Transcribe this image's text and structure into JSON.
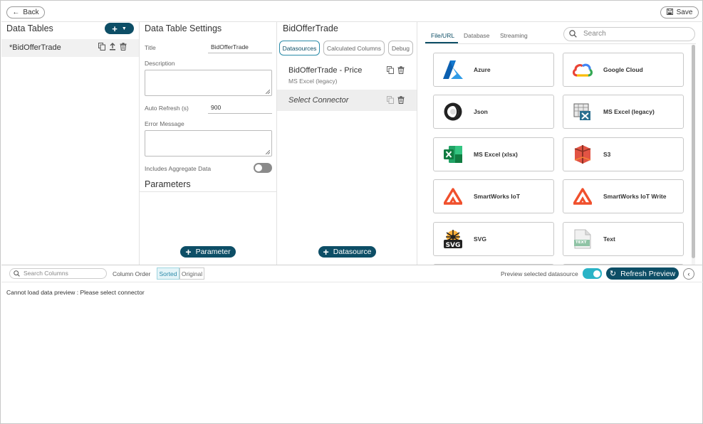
{
  "topbar": {
    "back_label": "Back",
    "save_label": "Save"
  },
  "data_tables": {
    "title": "Data Tables",
    "add_label": "+",
    "items": [
      {
        "label": "*BidOfferTrade"
      }
    ]
  },
  "settings": {
    "title": "Data Table Settings",
    "title_label": "Title",
    "title_value": "BidOfferTrade",
    "description_label": "Description",
    "auto_refresh_label": "Auto Refresh (s)",
    "auto_refresh_value": "900",
    "error_message_label": "Error Message",
    "aggregate_label": "Includes Aggregate Data",
    "aggregate_on": false,
    "parameters_title": "Parameters",
    "add_parameter_label": "Parameter"
  },
  "datasource_panel": {
    "title": "BidOfferTrade",
    "tabs": [
      "Datasources",
      "Calculated Columns",
      "Debug"
    ],
    "active_tab": "Datasources",
    "items": [
      {
        "name": "BidOfferTrade - Price",
        "sub": "MS Excel (legacy)"
      },
      {
        "name": "Select Connector",
        "sub": ""
      }
    ],
    "add_datasource_label": "Datasource"
  },
  "connectors": {
    "tabs": [
      "File/URL",
      "Database",
      "Streaming"
    ],
    "active_tab": "File/URL",
    "search_placeholder": "Search",
    "items": [
      {
        "label": "Azure",
        "icon": "azure-icon"
      },
      {
        "label": "Google Cloud",
        "icon": "google-cloud-icon"
      },
      {
        "label": "Json",
        "icon": "json-icon"
      },
      {
        "label": "MS Excel (legacy)",
        "icon": "excel-legacy-icon"
      },
      {
        "label": "MS Excel (xlsx)",
        "icon": "excel-xlsx-icon"
      },
      {
        "label": "S3",
        "icon": "s3-icon"
      },
      {
        "label": "SmartWorks IoT",
        "icon": "smartworks-icon"
      },
      {
        "label": "SmartWorks IoT Write",
        "icon": "smartworks-write-icon"
      },
      {
        "label": "SVG",
        "icon": "svg-icon"
      },
      {
        "label": "Text",
        "icon": "text-icon",
        "icon_text": "TEXT"
      }
    ]
  },
  "preview_bar": {
    "search_placeholder": "Search Columns",
    "column_order_label": "Column Order",
    "sorted_label": "Sorted",
    "original_label": "Original",
    "preview_selected_label": "Preview selected datasource",
    "preview_selected_on": true,
    "refresh_label": "Refresh Preview"
  },
  "preview": {
    "message": "Cannot load data preview : Please select connector"
  },
  "colors": {
    "primary": "#0d4e66",
    "accent": "#2a8aa8",
    "toggle_on": "#2ab3c6"
  }
}
